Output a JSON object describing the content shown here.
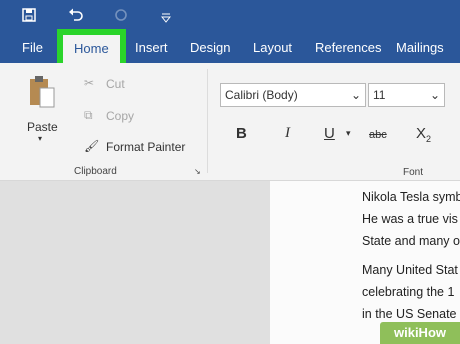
{
  "ribbon_tabs": [
    "File",
    "Home",
    "Insert",
    "Design",
    "Layout",
    "References",
    "Mailings"
  ],
  "clipboard": {
    "paste_label": "Paste",
    "cut_label": "Cut",
    "copy_label": "Copy",
    "format_painter_label": "Format Painter",
    "group_label": "Clipboard"
  },
  "font": {
    "font_name": "Calibri (Body)",
    "font_size": "11",
    "bold": "B",
    "italic": "I",
    "underline": "U",
    "strike": "abc",
    "subscript": "X",
    "subscript_small": "2",
    "group_label": "Font"
  },
  "document": {
    "lines": [
      "Nikola Tesla symb",
      "He was a true vis",
      "State and many o",
      "Many United Stat",
      "celebrating the 1",
      "in the US Senate"
    ]
  },
  "watermark": "wikiHow",
  "colors": {
    "ribbon_blue": "#2b579a",
    "highlight_green": "#2ad42a"
  }
}
